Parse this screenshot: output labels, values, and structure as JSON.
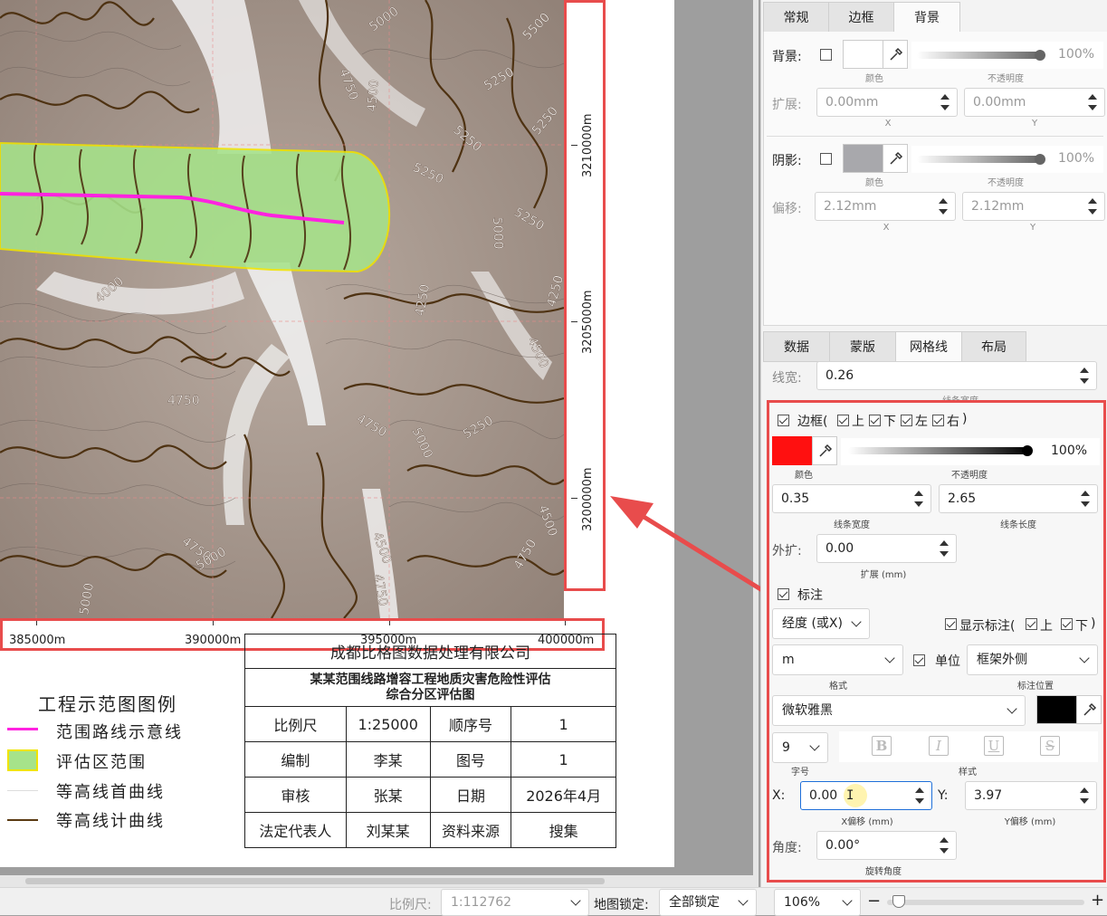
{
  "map": {
    "contour_labels": [
      "5000",
      "4750",
      "5500",
      "4500",
      "5250",
      "5250",
      "5250",
      "5250",
      "5250",
      "5000",
      "4000",
      "4250",
      "4250",
      "4750",
      "4750",
      "4500",
      "5000",
      "5250",
      "4500",
      "4750",
      "4750",
      "5000",
      "5000",
      "4500",
      "4750",
      "4750",
      "5000",
      "5000",
      "4500"
    ],
    "x_coords": [
      "385000m",
      "390000m",
      "395000m",
      "400000m"
    ],
    "y_coords": [
      "3210000m",
      "3205000m",
      "3200000m"
    ]
  },
  "legend": {
    "title": "工程示范图图例",
    "items": [
      {
        "label": "范围路线示意线",
        "color": "#ff22e0"
      },
      {
        "label": "评估区范围",
        "color": "#a6e38a"
      },
      {
        "label": "等高线首曲线",
        "color": "#dddddd"
      },
      {
        "label": "等高线计曲线",
        "color": "#5a3a12"
      }
    ]
  },
  "title_block": {
    "company": "成都比格图数据处理有限公司",
    "project_line1": "某某范围线路增容工程地质灾害危险性评估",
    "project_line2": "综合分区评估图",
    "rows": [
      [
        "比例尺",
        "1:25000",
        "顺序号",
        "1"
      ],
      [
        "编制",
        "李某",
        "图号",
        "1"
      ],
      [
        "审核",
        "张某",
        "日期",
        "2026年4月"
      ],
      [
        "法定代表人",
        "刘某某",
        "资料来源",
        "搜集"
      ]
    ]
  },
  "panel_top": {
    "tabs": [
      "常规",
      "边框",
      "背景"
    ],
    "active_tab": "背景",
    "background": {
      "label": "背景:",
      "color_sub": "颜色",
      "opacity": "100%",
      "opacity_sub": "不透明度"
    },
    "expand": {
      "label": "扩展:",
      "x": "0.00mm",
      "y": "0.00mm",
      "x_sub": "X",
      "y_sub": "Y"
    },
    "shadow": {
      "label": "阴影:",
      "color_sub": "颜色",
      "opacity": "100%",
      "opacity_sub": "不透明度",
      "swatch": "#a8a8ac"
    },
    "offset": {
      "label": "偏移:",
      "x": "2.12mm",
      "y": "2.12mm",
      "x_sub": "X",
      "y_sub": "Y"
    }
  },
  "panel_bottom": {
    "tabs": [
      "数据",
      "蒙版",
      "网格线",
      "布局"
    ],
    "active_tab": "网格线",
    "linewidth": {
      "label": "线宽:",
      "value": "0.26",
      "sub": "线条宽度"
    },
    "border": {
      "label": "边框(",
      "top": "上",
      "bottom": "下",
      "left": "左",
      "right": "右",
      "close": ")",
      "color": "#ff1010",
      "color_sub": "颜色",
      "opacity": "100%",
      "opacity_sub": "不透明度",
      "width": "0.35",
      "width_sub": "线条宽度",
      "length": "2.65",
      "length_sub": "线条长度",
      "expand_label": "外扩:",
      "expand": "0.00",
      "expand_sub": "扩展 (mm)"
    },
    "annotation": {
      "label": "标注",
      "axis": "经度 (或X)",
      "show_label": "显示标注(",
      "show_top": "上",
      "show_bottom": "下",
      "close": ")",
      "unit_value": "m",
      "format_sub": "格式",
      "unit_label": "单位",
      "position": "框架外侧",
      "position_sub": "标注位置",
      "font": "微软雅黑",
      "font_color": "#000000",
      "size": "9",
      "size_sub": "字号",
      "style_sub": "样式",
      "x_label": "X:",
      "x_value": "0.00",
      "x_sub": "X偏移 (mm)",
      "y_label": "Y:",
      "y_value": "3.97",
      "y_sub": "Y偏移 (mm)",
      "angle_label": "角度:",
      "angle": "0.00°",
      "angle_sub": "旋转角度"
    }
  },
  "status": {
    "scale_label": "比例尺:",
    "scale_value": "1:112762",
    "lock_label": "地图锁定:",
    "lock_value": "全部锁定",
    "zoom": "106%",
    "minus": "−",
    "plus": "+"
  },
  "colors": {
    "accent": "#e84c4c",
    "route": "#ff22e0",
    "area": "#a6e38a"
  }
}
